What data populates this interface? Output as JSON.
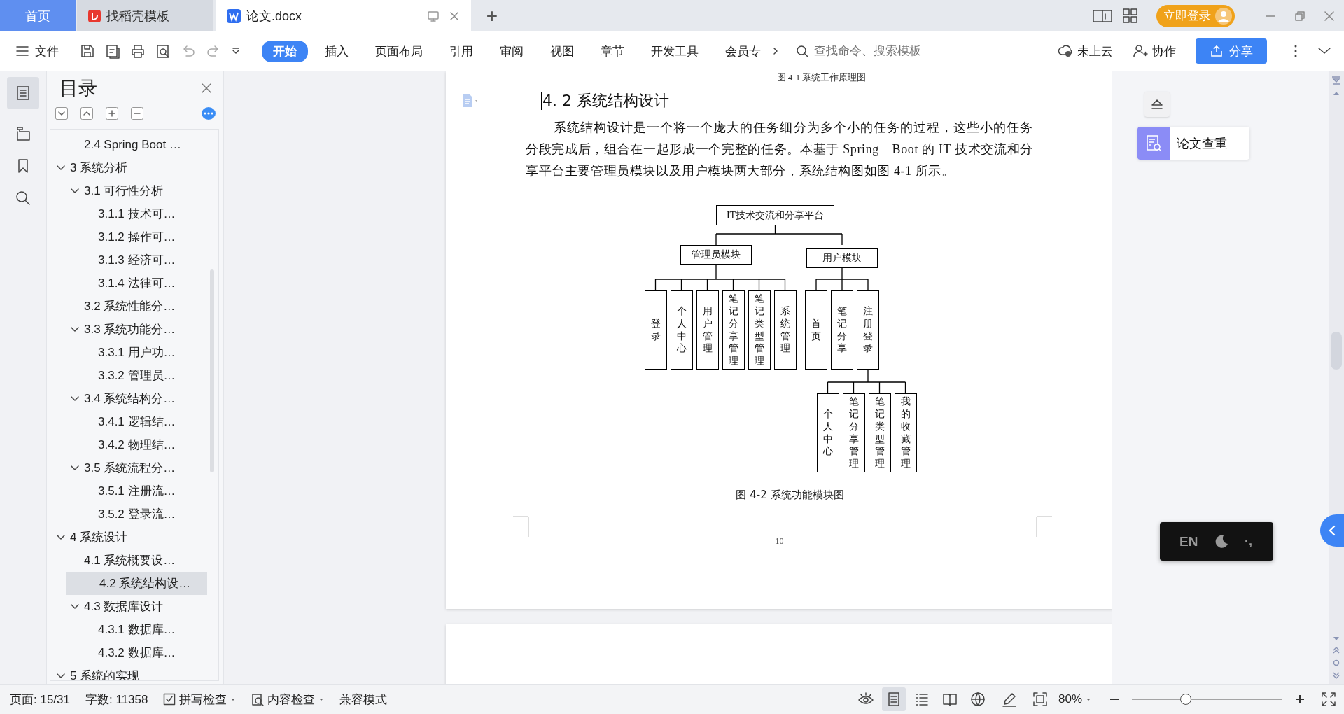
{
  "tabs": [
    {
      "label": "首页",
      "kind": "home",
      "selected": false
    },
    {
      "label": "找稻壳模板",
      "kind": "template",
      "selected": false
    },
    {
      "label": "论文.docx",
      "kind": "document",
      "selected": true
    }
  ],
  "new_tab": "+",
  "login_button": "立即登录",
  "ribbon": {
    "file_menu": "文件",
    "tabs": [
      {
        "label": "开始",
        "selected": true
      },
      {
        "label": "插入",
        "selected": false
      },
      {
        "label": "页面布局",
        "selected": false
      },
      {
        "label": "引用",
        "selected": false
      },
      {
        "label": "审阅",
        "selected": false
      },
      {
        "label": "视图",
        "selected": false
      },
      {
        "label": "章节",
        "selected": false
      },
      {
        "label": "开发工具",
        "selected": false
      },
      {
        "label": "会员专",
        "selected": false
      }
    ],
    "search": {
      "placeholder": "查找命令、搜索模板"
    },
    "cloud": "未上云",
    "collaborate": "协作",
    "share": "分享"
  },
  "sidebar": {
    "title": "目录",
    "outline": [
      {
        "children": [
          {
            "label": "2.4 Spring Boot …",
            "selected": false
          }
        ]
      },
      {
        "label": "3  系统分析",
        "expanded": true,
        "selected": false,
        "children": [
          {
            "label": "3.1  可行性分析",
            "expanded": true,
            "selected": false,
            "children": [
              {
                "label": "3.1.1  技术可…",
                "selected": false
              },
              {
                "label": "3.1.2  操作可…",
                "selected": false
              },
              {
                "label": "3.1.3  经济可…",
                "selected": false
              },
              {
                "label": "3.1.4  法律可…",
                "selected": false
              }
            ]
          },
          {
            "label": "3.2 系统性能分…",
            "selected": false
          },
          {
            "label": "3.3 系统功能分…",
            "expanded": true,
            "selected": false,
            "children": [
              {
                "label": "3.3.1 用户功…",
                "selected": false
              },
              {
                "label": "3.3.2 管理员…",
                "selected": false
              }
            ]
          },
          {
            "label": "3.4  系统结构分…",
            "expanded": true,
            "selected": false,
            "children": [
              {
                "label": "3.4.1 逻辑结…",
                "selected": false
              },
              {
                "label": "3.4.2 物理结…",
                "selected": false
              }
            ]
          },
          {
            "label": "3.5  系统流程分…",
            "expanded": true,
            "selected": false,
            "children": [
              {
                "label": "3.5.1 注册流…",
                "selected": false
              },
              {
                "label": "3.5.2 登录流…",
                "selected": false
              }
            ]
          }
        ]
      },
      {
        "label": "4  系统设计",
        "expanded": true,
        "selected": false,
        "children": [
          {
            "label": "4.1 系统概要设…",
            "selected": false
          },
          {
            "label": "4.2 系统结构设…",
            "selected": true
          },
          {
            "label": "4.3  数据库设计",
            "expanded": true,
            "selected": false,
            "children": [
              {
                "label": "4.3.1  数据库…",
                "selected": false
              },
              {
                "label": "4.3.2  数据库…",
                "selected": false
              }
            ]
          }
        ]
      },
      {
        "label": "5  系统的实现",
        "expanded": true,
        "selected": false
      }
    ]
  },
  "document": {
    "prev_caption": "图 4-1  系统工作原理图",
    "heading": "4. 2 系统结构设计",
    "paragraph": "系统结构设计是一个将一个庞大的任务细分为多个小的任务的过程，这些小的任务分段完成后，组合在一起形成一个完整的任务。本基于 Spring　Boot 的 IT 技术交流和分享平台主要管理员模块以及用户模块两大部分，系统结构图如图 4-1 所示。",
    "diagram": {
      "label": "IT技术交流和分享平台",
      "children": [
        {
          "label": "管理员模块",
          "children": [
            {
              "label": "登录"
            },
            {
              "label": "个人中心"
            },
            {
              "label": "用户管理"
            },
            {
              "label": "笔记分享管理"
            },
            {
              "label": "笔记类型管理"
            },
            {
              "label": "系统管理"
            }
          ]
        },
        {
          "label": "用户模块",
          "children": [
            {
              "label": "首页"
            },
            {
              "label": "笔记分享"
            },
            {
              "label": "注册登录",
              "children": [
                {
                  "label": "个人中心"
                },
                {
                  "label": "笔记分享管理"
                },
                {
                  "label": "笔记类型管理"
                },
                {
                  "label": "我的收藏管理"
                }
              ]
            }
          ]
        }
      ]
    },
    "caption": "图 4-2 系统功能模块图",
    "page_number": "10"
  },
  "side_panel": {
    "check_button": "论文查重",
    "ime": "EN",
    "ime_punct": "·,"
  },
  "status_bar": {
    "page": "页面: 15/31",
    "words": "字数: 11358",
    "spell_check": "拼写检查",
    "content_check": "内容检查",
    "compat_mode": "兼容模式",
    "view_modes": [
      {
        "selected": true
      },
      {
        "selected": false
      },
      {
        "selected": false
      },
      {
        "selected": false
      }
    ],
    "zoom": "80%",
    "zoom_level": {
      "level": 0.36
    }
  }
}
